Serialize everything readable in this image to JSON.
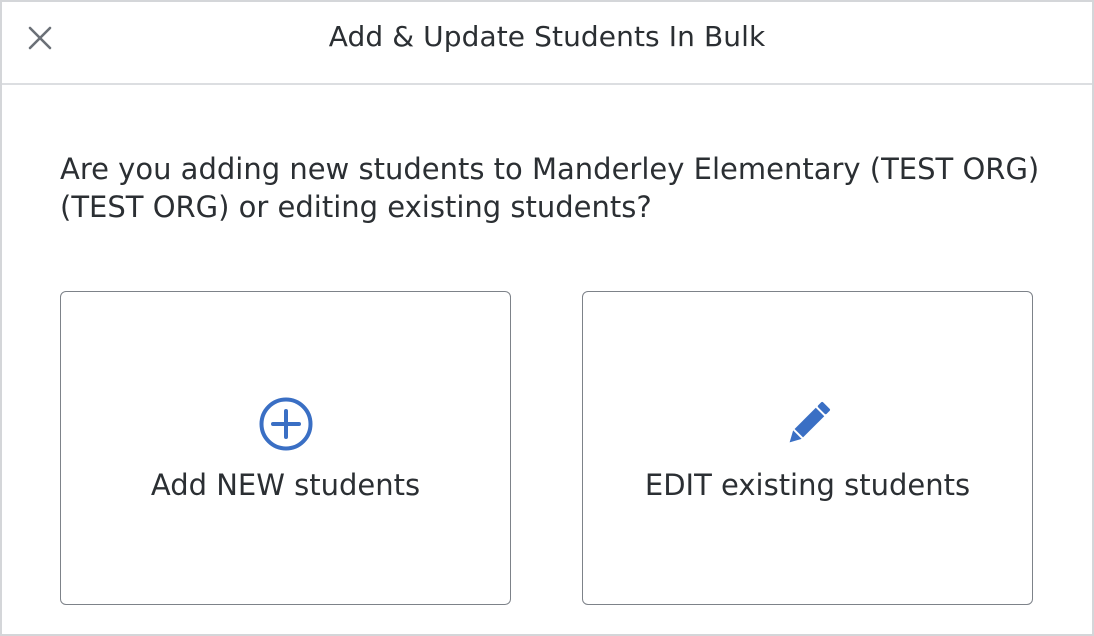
{
  "modal": {
    "title": "Add & Update Students In Bulk",
    "close_icon": "close-icon",
    "question": "Are you adding new students to Manderley Elementary (TEST ORG) (TEST ORG) or editing existing students?"
  },
  "options": [
    {
      "label": "Add NEW students",
      "icon": "plus-circle-icon"
    },
    {
      "label": "EDIT existing students",
      "icon": "pencil-icon"
    }
  ],
  "colors": {
    "accent": "#3a6fc4",
    "text": "#2b2f33",
    "border": "#7d8289",
    "close_icon": "#6b7077"
  }
}
